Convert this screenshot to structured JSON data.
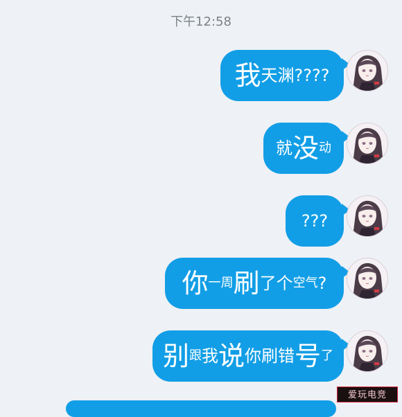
{
  "timestamp": "下午12:58",
  "messages": [
    {
      "segments": [
        {
          "text": "我",
          "size": "lg"
        },
        {
          "text": "天渊????",
          "size": "md"
        }
      ]
    },
    {
      "segments": [
        {
          "text": "就",
          "size": "md"
        },
        {
          "text": "没",
          "size": "lg"
        },
        {
          "text": "动",
          "size": "sm"
        }
      ]
    },
    {
      "segments": [
        {
          "text": "???",
          "size": "md"
        }
      ]
    },
    {
      "segments": [
        {
          "text": "你",
          "size": "lg"
        },
        {
          "text": "一周",
          "size": "sm"
        },
        {
          "text": "刷",
          "size": "lg"
        },
        {
          "text": "了个",
          "size": "md"
        },
        {
          "text": "空气",
          "size": "sm"
        },
        {
          "text": "?",
          "size": "md"
        }
      ]
    },
    {
      "segments": [
        {
          "text": "别",
          "size": "lg"
        },
        {
          "text": "跟",
          "size": "sm"
        },
        {
          "text": "我",
          "size": "md"
        },
        {
          "text": "说",
          "size": "lg"
        },
        {
          "text": "你刷错",
          "size": "md"
        },
        {
          "text": "号",
          "size": "lg"
        },
        {
          "text": "了",
          "size": "sm"
        }
      ]
    }
  ],
  "watermark": "爱玩电竞",
  "colors": {
    "bubble": "#129ee6",
    "background": "#eef1f5",
    "timestamp": "#7d8287"
  }
}
